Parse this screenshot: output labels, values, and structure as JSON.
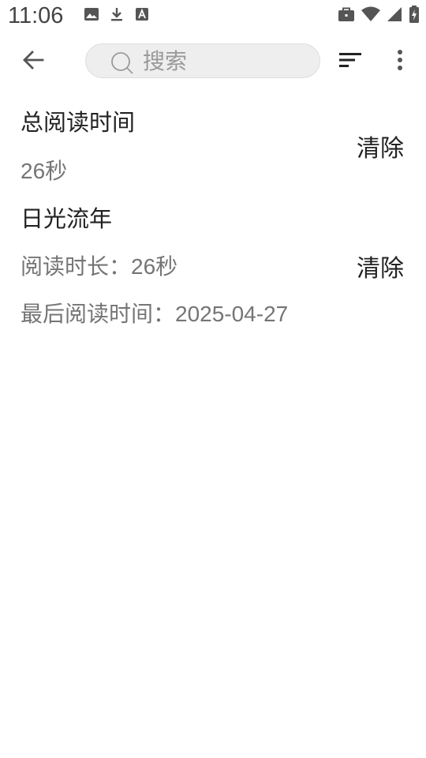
{
  "status_bar": {
    "time": "11:06",
    "left_icons": [
      "image-icon",
      "download-icon",
      "font-icon"
    ],
    "right_icons": [
      "briefcase-icon",
      "wifi-icon",
      "signal-icon",
      "battery-charging-icon"
    ]
  },
  "app_bar": {
    "back_icon": "arrow-back-icon",
    "search_placeholder": "搜索",
    "sort_icon": "sort-icon",
    "more_icon": "more-vert-icon"
  },
  "summary": {
    "title": "总阅读时间",
    "value": "26秒",
    "clear_label": "清除"
  },
  "books": [
    {
      "title": "日光流年",
      "duration": "阅读时长：26秒",
      "last_read": "最后阅读时间：2025-04-27",
      "clear_label": "清除"
    }
  ],
  "colors": {
    "primary_text": "#222222",
    "secondary_text": "#757575",
    "search_bg": "#eeeeee"
  }
}
